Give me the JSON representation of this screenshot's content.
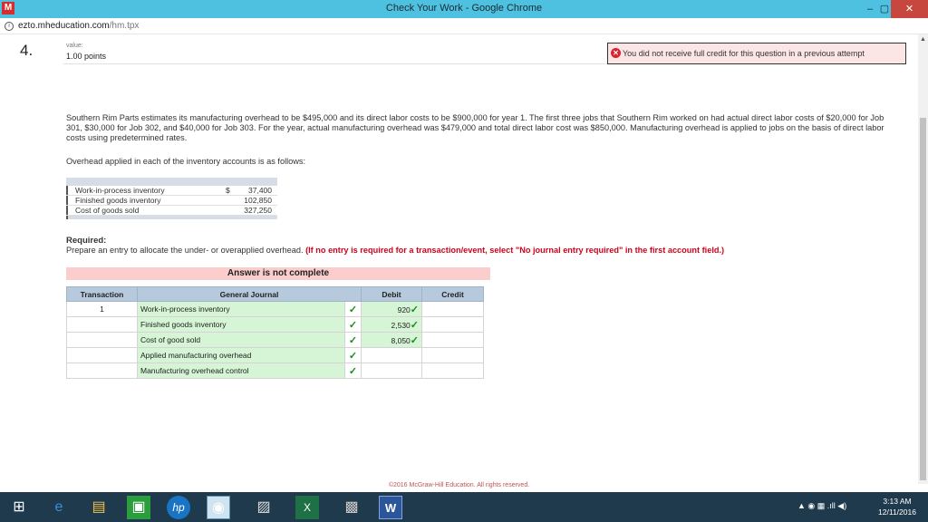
{
  "window": {
    "app_icon": "M",
    "title": "Check Your Work - Google Chrome",
    "min": "–",
    "max": "▢",
    "close": "✕"
  },
  "address": {
    "host": "ezto.mheducation.com",
    "path": "/hm.tpx"
  },
  "question": {
    "number": "4.",
    "value_label": "value:",
    "points": "1.00 points",
    "credit_message": "You did not receive full credit for this question in a previous attempt",
    "paragraph": "Southern Rim Parts estimates its manufacturing overhead to be $495,000 and its direct labor costs to be $900,000 for year 1. The first three jobs that Southern Rim worked on had actual direct labor costs of $20,000 for Job 301, $30,000 for Job 302, and $40,000 for Job 303. For the year, actual manufacturing overhead was $479,000 and total direct labor cost was $850,000. Manufacturing overhead is applied to jobs on the basis of direct labor costs using predetermined rates.",
    "applied_intro": "Overhead applied in each of the inventory accounts is as follows:",
    "inventory": [
      {
        "label": "Work-in-process inventory",
        "currency": "$",
        "amount": "37,400"
      },
      {
        "label": "Finished goods inventory",
        "currency": "",
        "amount": "102,850"
      },
      {
        "label": "Cost of goods sold",
        "currency": "",
        "amount": "327,250"
      }
    ],
    "required_title": "Required:",
    "required_text": "Prepare an entry to allocate the under- or overapplied overhead.",
    "required_note": "(If no entry is required for a transaction/event, select \"No journal entry required\" in the first account field.)"
  },
  "answer": {
    "banner": "Answer is not complete",
    "headers": {
      "transaction": "Transaction",
      "journal": "General Journal",
      "debit": "Debit",
      "credit": "Credit"
    },
    "rows": [
      {
        "transaction": "1",
        "account": "Work-in-process inventory",
        "debit": "920"
      },
      {
        "transaction": "",
        "account": "Finished goods inventory",
        "debit": "2,530"
      },
      {
        "transaction": "",
        "account": "Cost of good sold",
        "debit": "8,050"
      },
      {
        "transaction": "",
        "account": "Applied manufacturing overhead",
        "debit": ""
      },
      {
        "transaction": "",
        "account": "Manufacturing overhead control",
        "debit": ""
      }
    ],
    "check": "✓"
  },
  "footer": {
    "copyright": "©2016 McGraw-Hill Education. All rights reserved."
  },
  "taskbar": {
    "clock_time": "3:13 AM",
    "clock_date": "12/11/2016",
    "tray": "▲  ◉  ▦  .ıll  ◀)"
  }
}
